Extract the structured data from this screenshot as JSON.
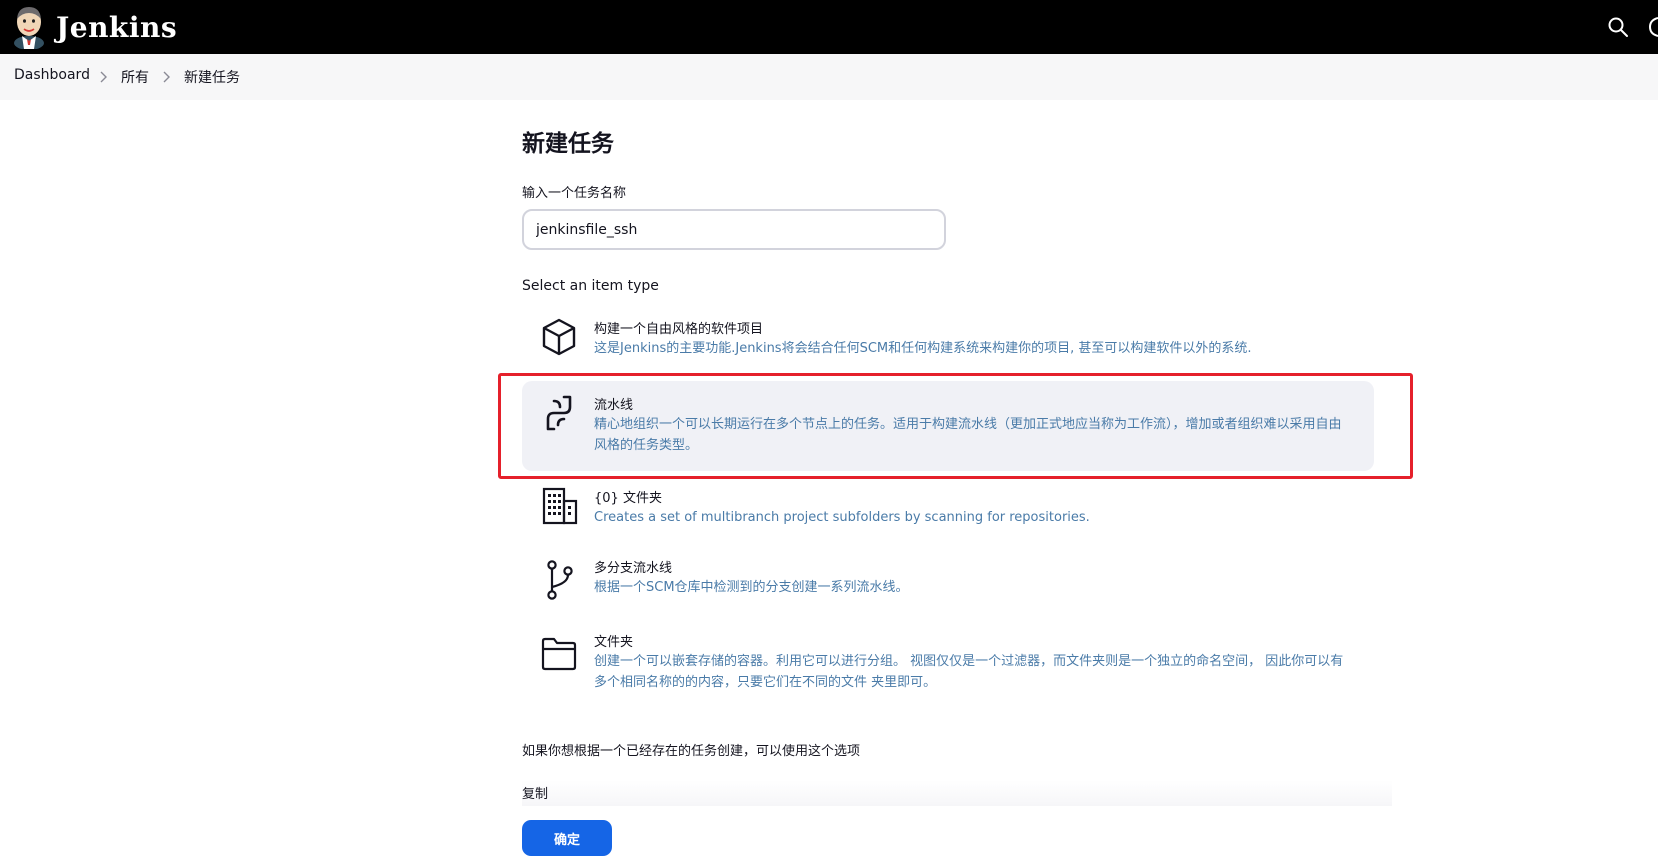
{
  "header": {
    "logo_text": "Jenkins"
  },
  "breadcrumb": [
    {
      "label": "Dashboard"
    },
    {
      "label": "所有"
    },
    {
      "label": "新建任务"
    }
  ],
  "page": {
    "title": "新建任务",
    "name_label": "输入一个任务名称",
    "name_value": "jenkinsfile_ssh",
    "select_label": "Select an item type"
  },
  "items": [
    {
      "title": "构建一个自由风格的软件项目",
      "desc": "这是Jenkins的主要功能.Jenkins将会结合任何SCM和任何构建系统来构建你的项目, 甚至可以构建软件以外的系统.",
      "icon": "cube-icon"
    },
    {
      "title": "流水线",
      "desc": "精心地组织一个可以长期运行在多个节点上的任务。适用于构建流水线（更加正式地应当称为工作流），增加或者组织难以采用自由风格的任务类型。",
      "icon": "pipeline-icon",
      "selected": true
    },
    {
      "title": "{0} 文件夹",
      "desc": "Creates a set of multibranch project subfolders by scanning for repositories.",
      "icon": "organization-folder-icon"
    },
    {
      "title": "多分支流水线",
      "desc": "根据一个SCM仓库中检测到的分支创建一系列流水线。",
      "icon": "branch-icon"
    },
    {
      "title": "文件夹",
      "desc": "创建一个可以嵌套存储的容器。利用它可以进行分组。 视图仅仅是一个过滤器，而文件夹则是一个独立的命名空间， 因此你可以有多个相同名称的的内容，只要它们在不同的文件 夹里即可。",
      "icon": "folder-icon"
    }
  ],
  "copy": {
    "hint": "如果你想根据一个已经存在的任务创建，可以使用这个选项",
    "label": "复制"
  },
  "ok_label": "确定",
  "colors": {
    "header_bg": "#000000",
    "accent": "#1565e6",
    "highlight": "#e5202b",
    "desc_text": "#4a7ba8"
  }
}
